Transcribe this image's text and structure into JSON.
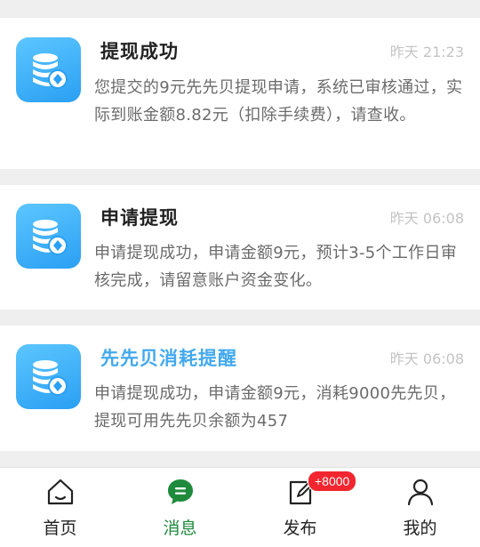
{
  "messages": [
    {
      "title": "提现成功",
      "time": "昨天 21:23",
      "body": "您提交的9元先先贝提现申请，系统已审核通过，实际到账金额8.82元（扣除手续费），请查收。",
      "icon": "coin-stack-icon"
    },
    {
      "title": "申请提现",
      "time": "昨天 06:08",
      "body": "申请提现成功，申请金额9元，预计3-5个工作日审核完成，请留意账户资金变化。",
      "icon": "coin-stack-icon"
    },
    {
      "title": "先先贝消耗提醒",
      "time": "昨天 06:08",
      "body": "申请提现成功，申请金额9元，消耗9000先先贝，提现可用先先贝余额为457",
      "icon": "coin-stack-icon"
    }
  ],
  "tabbar": {
    "home": "首页",
    "messages": "消息",
    "publish": "发布",
    "mine": "我的",
    "publish_badge": "+8000"
  },
  "colors": {
    "active_tab": "#1e8a3c",
    "highlight_title": "#43a9ee",
    "badge": "#f2262f",
    "icon_gradient_top": "#5cc6ff",
    "icon_gradient_bottom": "#2a9ff3"
  }
}
